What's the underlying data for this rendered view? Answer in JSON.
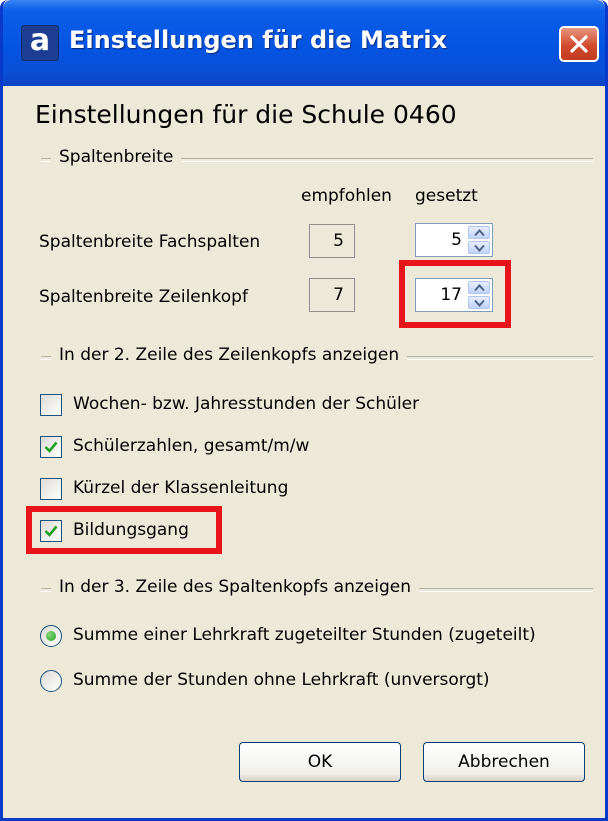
{
  "window": {
    "app_icon_letter": "a",
    "title": "Einstellungen für die Matrix",
    "close_icon": "close-x-icon"
  },
  "heading": "Einstellungen für die Schule 0460",
  "column_width": {
    "section_title": "Spaltenbreite",
    "header_recommended": "empfohlen",
    "header_set": "gesetzt",
    "rows": [
      {
        "label": "Spaltenbreite Fachspalten",
        "recommended": "5",
        "set": "5"
      },
      {
        "label": "Spaltenbreite Zeilenkopf",
        "recommended": "7",
        "set": "17"
      }
    ]
  },
  "row_header": {
    "section_title": "In der 2. Zeile des Zeilenkopfs anzeigen",
    "options": [
      {
        "label": "Wochen- bzw. Jahresstunden der Schüler",
        "checked": false
      },
      {
        "label": "Schülerzahlen, gesamt/m/w",
        "checked": true
      },
      {
        "label": "Kürzel der Klassenleitung",
        "checked": false
      },
      {
        "label": "Bildungsgang",
        "checked": true
      }
    ]
  },
  "column_header": {
    "section_title": "In der 3. Zeile des Spaltenkopfs anzeigen",
    "options": [
      {
        "label": "Summe einer Lehrkraft zugeteilter Stunden (zugeteilt)",
        "selected": true
      },
      {
        "label": "Summe der Stunden ohne Lehrkraft (unversorgt)",
        "selected": false
      }
    ]
  },
  "buttons": {
    "ok": "OK",
    "cancel": "Abbrechen"
  },
  "colors": {
    "titlebar": "#0454e3",
    "dialog_bg": "#ece9d8",
    "highlight": "#e8141c"
  }
}
